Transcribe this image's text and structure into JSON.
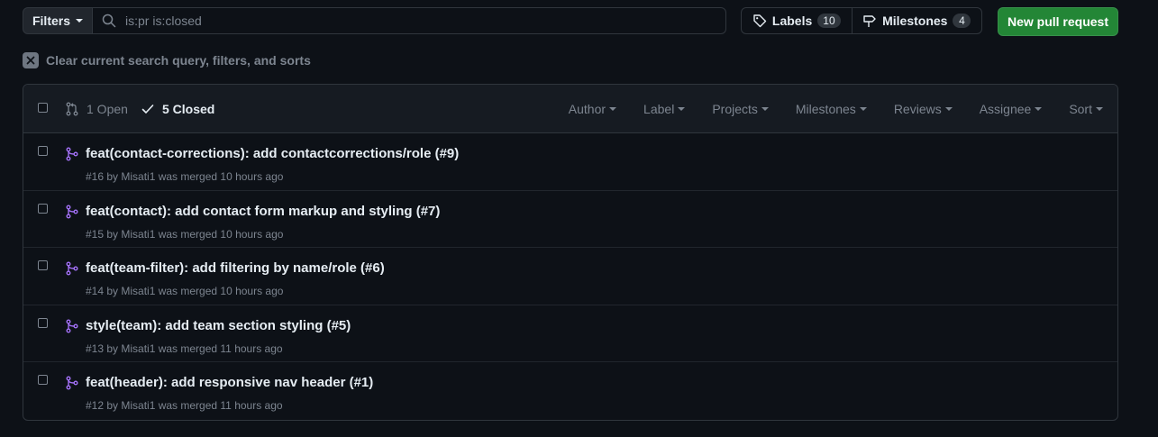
{
  "toolbar": {
    "filters_label": "Filters",
    "search_value": "is:pr is:closed",
    "labels_label": "Labels",
    "labels_count": "10",
    "milestones_label": "Milestones",
    "milestones_count": "4",
    "new_pr_label": "New pull request"
  },
  "clear_query": {
    "label": "Clear current search query, filters, and sorts"
  },
  "list_header": {
    "open_label": "1 Open",
    "closed_label": "5 Closed",
    "filters": [
      "Author",
      "Label",
      "Projects",
      "Milestones",
      "Reviews",
      "Assignee",
      "Sort"
    ]
  },
  "pull_requests": [
    {
      "title": "feat(contact-corrections): add contactcorrections/role (#9)",
      "meta": "#16 by Misati1 was merged 10 hours ago"
    },
    {
      "title": "feat(contact): add contact form markup and styling (#7)",
      "meta": "#15 by Misati1 was merged 10 hours ago"
    },
    {
      "title": "feat(team-filter): add filtering by name/role (#6)",
      "meta": "#14 by Misati1 was merged 10 hours ago"
    },
    {
      "title": "style(team): add team section styling (#5)",
      "meta": "#13 by Misati1 was merged 11 hours ago"
    },
    {
      "title": "feat(header): add responsive nav header (#1)",
      "meta": "#12 by Misati1 was merged 11 hours ago"
    }
  ],
  "colors": {
    "background": "#0d1117",
    "accent_green": "#238636",
    "merged_purple": "#a371f7",
    "muted_text": "#7d8590"
  },
  "icons": {
    "search": "search-icon",
    "tag": "tag-icon",
    "milestone": "milestone-icon",
    "clear": "x-icon",
    "pr_open": "git-pull-request-icon",
    "check": "check-icon",
    "merged": "git-merge-icon"
  }
}
